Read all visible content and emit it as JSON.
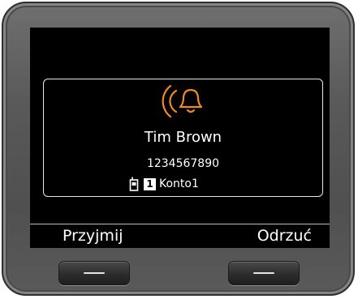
{
  "call": {
    "caller_name": "Tim Brown",
    "caller_number": "1234567890",
    "line_number": "1",
    "account_name": "Konto1"
  },
  "softkeys": {
    "left_label": "Przyjmij",
    "right_label": "Odrzuć"
  },
  "icons": {
    "ringing": "ringing-bell-icon",
    "handset": "handset-icon"
  },
  "colors": {
    "accent": "#f08a24",
    "screen_background": "#000000",
    "text": "#ffffff"
  }
}
